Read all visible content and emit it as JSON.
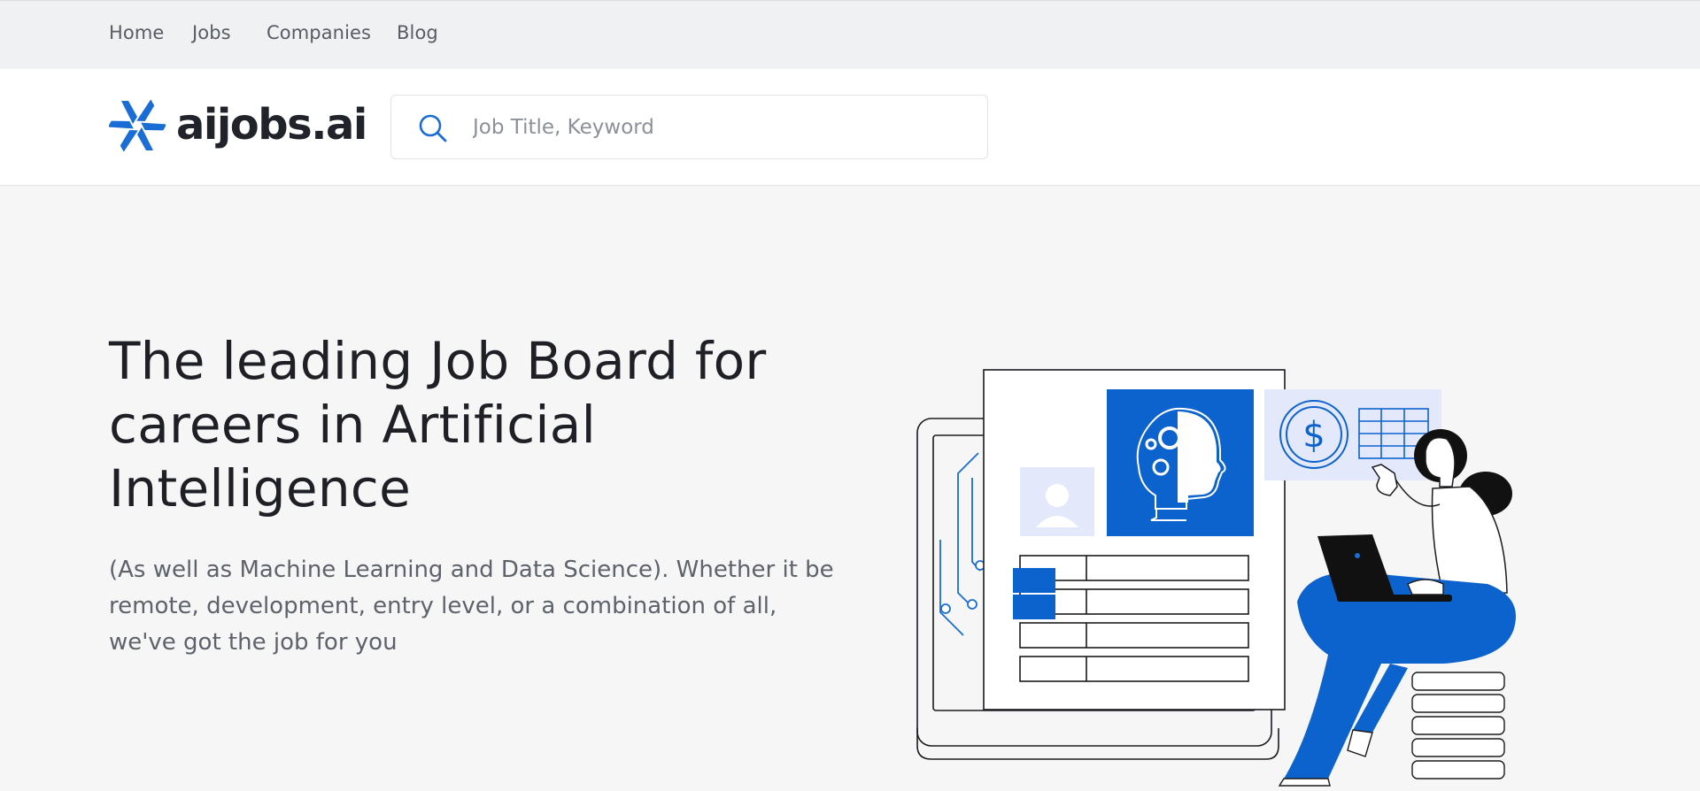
{
  "nav": {
    "items": [
      {
        "label": "Home"
      },
      {
        "label": "Jobs"
      },
      {
        "label": "Companies"
      },
      {
        "label": "Blog"
      }
    ]
  },
  "header": {
    "logo_text": "aijobs.ai",
    "logo_icon": "pinwheel-logo-icon",
    "search": {
      "placeholder": "Job Title, Keyword",
      "value": "",
      "icon": "search-icon"
    }
  },
  "hero": {
    "title": "The leading Job Board for careers in Artificial Intelligence",
    "subtitle": "(As well as Machine Learning and Data Science). Whether it be remote, development, entry level, or a combination of all, we've got the job for you"
  },
  "illustration": {
    "icons": [
      "laptop-icon",
      "document-icon",
      "ai-head-icon",
      "user-profile-icon",
      "dollar-icon",
      "table-icon",
      "person-with-laptop-icon",
      "coin-stack-icon"
    ]
  },
  "colors": {
    "accent": "#0d63ce",
    "accent_light": "#e3e8fa",
    "nav_bg": "#f0f1f3",
    "page_bg": "#f6f6f7"
  }
}
